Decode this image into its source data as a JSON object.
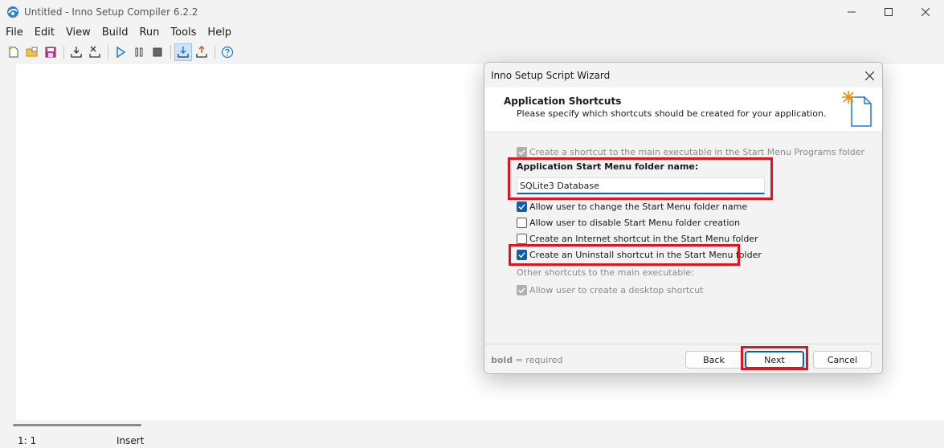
{
  "window": {
    "title": "Untitled - Inno Setup Compiler 6.2.2",
    "controls": [
      "minimize-icon",
      "maximize-icon",
      "close-icon"
    ]
  },
  "menu": [
    "File",
    "Edit",
    "View",
    "Build",
    "Run",
    "Tools",
    "Help"
  ],
  "toolbar": [
    "new-file-icon",
    "open-icon",
    "save-icon",
    "compile-icon",
    "stop-compile-icon",
    "run-icon",
    "pause-icon",
    "stop-icon",
    "target-setup-icon",
    "target-uninstall-icon",
    "help-icon"
  ],
  "status": {
    "position": "1:   1",
    "mode": "Insert"
  },
  "dialog": {
    "title": "Inno Setup Script Wizard",
    "heading": "Application Shortcuts",
    "subheading": "Please specify which shortcuts should be created for your application.",
    "options": {
      "main_shortcut": "Create a shortcut to the main executable in the Start Menu Programs folder",
      "folder_label": "Application Start Menu folder name:",
      "folder_value": "SQLite3 Database",
      "allow_change": "Allow user to change the Start Menu folder name",
      "allow_disable": "Allow user to disable Start Menu folder creation",
      "internet_shortcut": "Create an Internet shortcut in the Start Menu folder",
      "uninstall_shortcut": "Create an Uninstall shortcut in the Start Menu folder",
      "other_label": "Other shortcuts to the main executable:",
      "desktop_shortcut": "Allow user to create a desktop shortcut"
    },
    "footer": {
      "hint_bold": "bold",
      "hint_rest": " = required",
      "back": "Back",
      "next": "Next",
      "cancel": "Cancel"
    }
  },
  "colors": {
    "accent": "#0a5fb5",
    "highlight": "#e0141e"
  }
}
